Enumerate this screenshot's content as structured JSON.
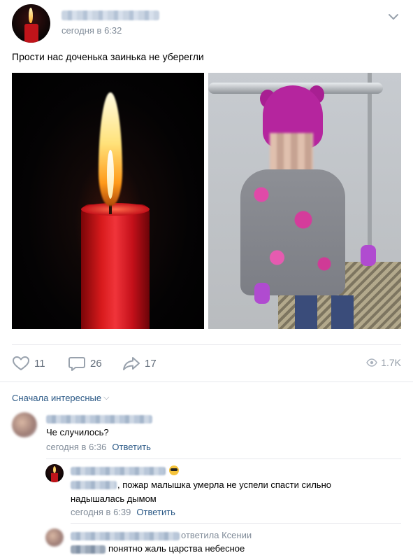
{
  "post": {
    "author_name": "",
    "time": "сегодня в 6:32",
    "text": "Прости нас доченька заинька не уберегли",
    "photos": [
      "candle-photo",
      "child-photo"
    ]
  },
  "actions": {
    "likes": "11",
    "comments": "26",
    "shares": "17",
    "views": "1.7K"
  },
  "comments": {
    "sort_label": "Сначала интересные",
    "items": [
      {
        "author": "",
        "text": "Че случилось?",
        "time": "сегодня в 6:36",
        "reply_label": "Ответить"
      },
      {
        "author": "",
        "text_line1": ", пожар малышка умерла не успели спасти сильно",
        "text_line2": "надышалась дымом",
        "time": "сегодня в 6:39",
        "reply_label": "Ответить"
      },
      {
        "author": "",
        "reply_to": "ответила Ксении",
        "text": "понятно жаль царства небесное"
      }
    ]
  },
  "colors": {
    "link": "#2a5885",
    "meta": "#818c99",
    "icon": "#99a2ad"
  }
}
